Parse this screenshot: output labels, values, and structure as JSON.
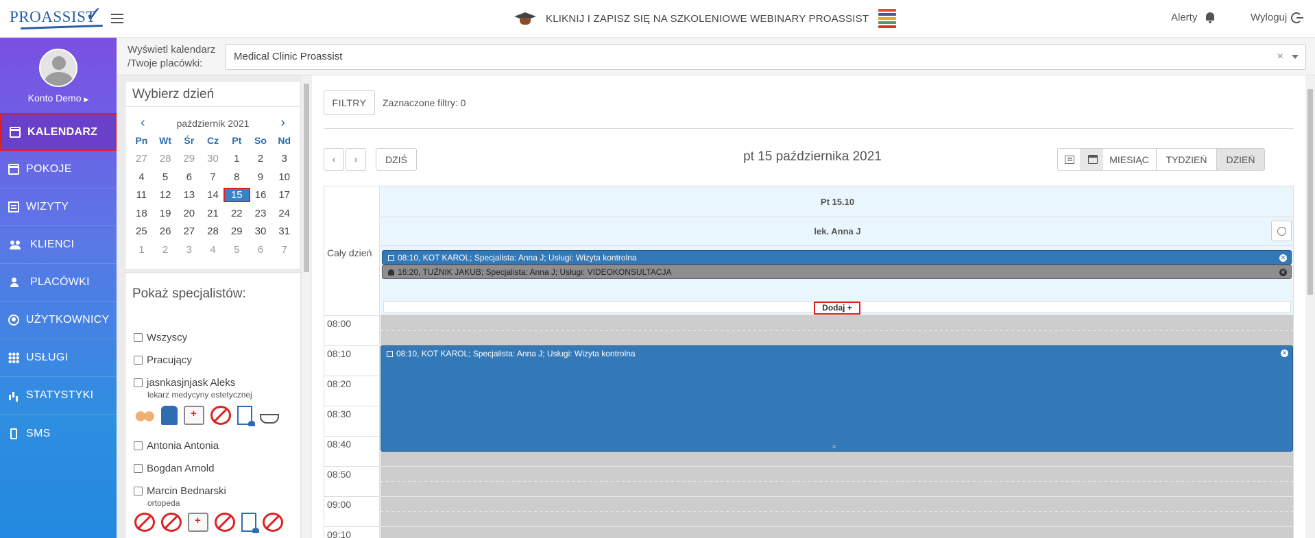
{
  "brand": {
    "logo_text": "PROASSIST"
  },
  "topbar": {
    "banner_text": "KLIKNIJ I ZAPISZ SIĘ NA SZKOLENIOWE WEBINARY PROASSIST",
    "alerts_label": "Alerty",
    "logout_label": "Wyloguj"
  },
  "sidebar": {
    "profile_name": "Konto Demo",
    "items": [
      {
        "label": "KALENDARZ",
        "icon": "calendar-icon",
        "active": true
      },
      {
        "label": "POKOJE",
        "icon": "calendar-icon"
      },
      {
        "label": "WIZYTY",
        "icon": "list-icon"
      },
      {
        "label": "KLIENCI",
        "icon": "users-icon"
      },
      {
        "label": "PLACÓWKI",
        "icon": "user-plus-icon"
      },
      {
        "label": "UŻYTKOWNICY",
        "icon": "user-circle-icon"
      },
      {
        "label": "USŁUGI",
        "icon": "grid-icon"
      },
      {
        "label": "STATYSTYKI",
        "icon": "bar-chart-icon"
      },
      {
        "label": "SMS",
        "icon": "phone-icon"
      }
    ],
    "accent_color": "#7b4fe3"
  },
  "filterbar": {
    "label_line1": "Wyświetl kalendarz",
    "label_line2": "/Twoje placówki:",
    "selected_clinic": "Medical Clinic Proassist",
    "clear": "×"
  },
  "day_picker": {
    "title": "Wybierz dzień",
    "month_label": "październik 2021",
    "prev": "‹",
    "next": "›",
    "weekdays": [
      "Pn",
      "Wt",
      "Śr",
      "Cz",
      "Pt",
      "So",
      "Nd"
    ],
    "weeks": [
      [
        "27",
        "28",
        "29",
        "30",
        "1",
        "2",
        "3"
      ],
      [
        "4",
        "5",
        "6",
        "7",
        "8",
        "9",
        "10"
      ],
      [
        "11",
        "12",
        "13",
        "14",
        "15",
        "16",
        "17"
      ],
      [
        "18",
        "19",
        "20",
        "21",
        "22",
        "23",
        "24"
      ],
      [
        "25",
        "26",
        "27",
        "28",
        "29",
        "30",
        "31"
      ],
      [
        "1",
        "2",
        "3",
        "4",
        "5",
        "6",
        "7"
      ]
    ],
    "selected_day": "15"
  },
  "specialists": {
    "title": "Pokaż specjalistów:",
    "items": [
      {
        "name": "Wszyscy"
      },
      {
        "name": "Pracujący"
      },
      {
        "name": "jasnkasjnjask Aleks",
        "role": "lekarz medycyny estetycznej"
      },
      {
        "name": "Antonia Antonia"
      },
      {
        "name": "Bogdan Arnold"
      },
      {
        "name": "Marcin Bednarski",
        "role": "ortopeda"
      }
    ]
  },
  "toolbar": {
    "filters_label": "FILTRY",
    "filters_count": "Zaznaczone filtry: 0",
    "prev": "‹",
    "next": "›",
    "today_label": "DZIŚ",
    "date_title": "pt 15 października 2021",
    "month_label": "MIESIĄC",
    "week_label": "TYDZIEŃ",
    "day_label": "DZIEŃ"
  },
  "calendar": {
    "day_header": "Pt 15.10",
    "resource_header": "lek. Anna J",
    "allday_label": "Cały dzień",
    "allday_events": [
      {
        "text": "08:10, KOT KAROL; Specjalista: Anna J; Usługi: Wizyta kontrolna",
        "color": "#3378b7"
      },
      {
        "text": "16:20, TUŹNIK JAKUB; Specjalista: Anna J; Usługi: VIDEOKONSULTACJA",
        "color": "#8e8e8e"
      }
    ],
    "add_label": "Dodaj +",
    "time_slots": [
      "08:00",
      "08:10",
      "08:20",
      "08:30",
      "08:40",
      "08:50",
      "09:00",
      "09:10"
    ],
    "timed_event": {
      "text": "08:10, KOT KAROL; Specjalista: Anna J; Usługi: Wizyta kontrolna",
      "color": "#3378b7",
      "start": "08:10",
      "end": "08:40"
    },
    "resize_grip": "="
  }
}
